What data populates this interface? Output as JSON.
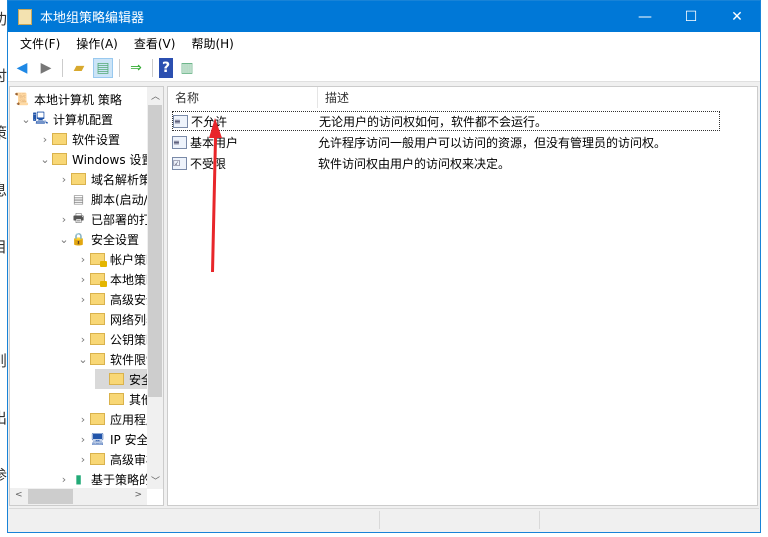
{
  "window": {
    "title": "本地组策略编辑器",
    "minimize": "—",
    "maximize": "☐",
    "close": "✕"
  },
  "menu": [
    "文件(F)",
    "操作(A)",
    "查看(V)",
    "帮助(H)"
  ],
  "background_chars": [
    "功",
    "讨",
    "策",
    "息",
    "目",
    "-",
    "则",
    "出",
    "参"
  ],
  "tree": [
    {
      "label": "本地计算机 策略",
      "level": 0,
      "chev": "",
      "icon": "policy"
    },
    {
      "label": "计算机配置",
      "level": 1,
      "chev": "⌄",
      "icon": "computer"
    },
    {
      "label": "软件设置",
      "level": 2,
      "chev": "›",
      "icon": "folder"
    },
    {
      "label": "Windows 设置",
      "level": 2,
      "chev": "⌄",
      "icon": "folder"
    },
    {
      "label": "域名解析策略",
      "level": 3,
      "chev": "›",
      "icon": "folder"
    },
    {
      "label": "脚本(启动/关机)",
      "level": 3,
      "chev": "",
      "icon": "script"
    },
    {
      "label": "已部署的打印机",
      "level": 3,
      "chev": "›",
      "icon": "printer"
    },
    {
      "label": "安全设置",
      "level": 3,
      "chev": "⌄",
      "icon": "security"
    },
    {
      "label": "帐户策略",
      "level": 4,
      "chev": "›",
      "icon": "folder-lock"
    },
    {
      "label": "本地策略",
      "level": 4,
      "chev": "›",
      "icon": "folder-lock"
    },
    {
      "label": "高级安全",
      "level": 4,
      "chev": "›",
      "icon": "folder"
    },
    {
      "label": "网络列表",
      "level": 4,
      "chev": "",
      "icon": "folder"
    },
    {
      "label": "公钥策略",
      "level": 4,
      "chev": "›",
      "icon": "folder"
    },
    {
      "label": "软件限制",
      "level": 4,
      "chev": "⌄",
      "icon": "folder"
    },
    {
      "label": "安全级别",
      "level": 5,
      "chev": "",
      "icon": "folder",
      "selected": true
    },
    {
      "label": "其他规则",
      "level": 5,
      "chev": "",
      "icon": "folder"
    },
    {
      "label": "应用程序",
      "level": 4,
      "chev": "›",
      "icon": "folder"
    },
    {
      "label": "IP 安全",
      "level": 4,
      "chev": "›",
      "icon": "ip"
    },
    {
      "label": "高级审核",
      "level": 4,
      "chev": "›",
      "icon": "folder"
    },
    {
      "label": "基于策略的QoS",
      "level": 3,
      "chev": "›",
      "icon": "chart"
    }
  ],
  "list": {
    "columns": [
      "名称",
      "描述"
    ],
    "rows": [
      {
        "name": "不允许",
        "desc": "无论用户的访问权如何，软件都不会运行。"
      },
      {
        "name": "基本用户",
        "desc": "允许程序访问一般用户可以访问的资源，但没有管理员的访问权。"
      },
      {
        "name": "不受限",
        "desc": "软件访问权由用户的访问权来决定。"
      }
    ]
  },
  "accent": "#0078d7",
  "annotation_color": "#e8262a"
}
